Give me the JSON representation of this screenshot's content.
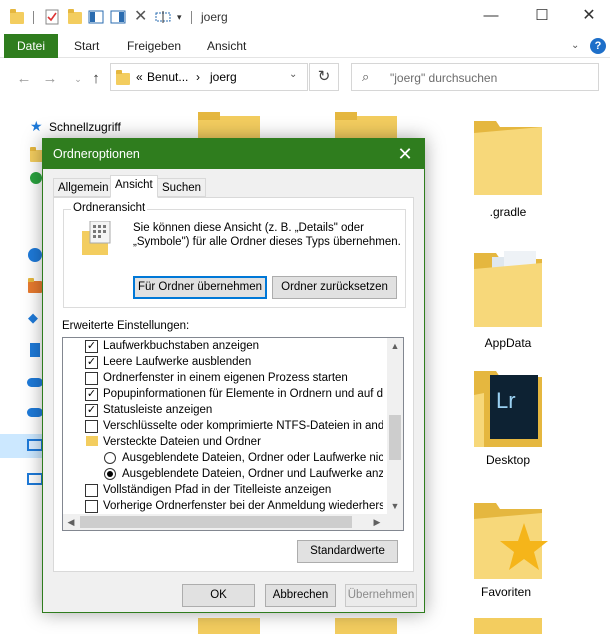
{
  "window": {
    "title": "joerg",
    "ribbon_tabs": [
      "Datei",
      "Start",
      "Freigeben",
      "Ansicht"
    ]
  },
  "address": {
    "prefix": "«",
    "crumb1": "Benut...",
    "sep": "›",
    "crumb2": "joerg",
    "search_placeholder": "\"joerg\" durchsuchen"
  },
  "navpane": {
    "quick_access": "Schnellzugriff"
  },
  "files": [
    {
      "name": ".gradle"
    },
    {
      "name": "AppData"
    },
    {
      "name": "Desktop"
    },
    {
      "name": "Favoriten"
    }
  ],
  "dialog": {
    "title": "Ordneroptionen",
    "tabs": [
      "Allgemein",
      "Ansicht",
      "Suchen"
    ],
    "group_label": "Ordneransicht",
    "group_text": "Sie können diese Ansicht (z. B. „Details\" oder „Symbole\") für alle Ordner dieses Typs übernehmen.",
    "apply_button": "Für Ordner übernehmen",
    "reset_button": "Ordner zurücksetzen",
    "advanced_label": "Erweiterte Einstellungen:",
    "settings": [
      {
        "type": "checkbox",
        "checked": true,
        "label": "Laufwerkbuchstaben anzeigen"
      },
      {
        "type": "checkbox",
        "checked": true,
        "label": "Leere Laufwerke ausblenden"
      },
      {
        "type": "checkbox",
        "checked": false,
        "label": "Ordnerfenster in einem eigenen Prozess starten"
      },
      {
        "type": "checkbox",
        "checked": true,
        "label": "Popupinformationen für Elemente in Ordnern und auf dem D"
      },
      {
        "type": "checkbox",
        "checked": true,
        "label": "Statusleiste anzeigen"
      },
      {
        "type": "checkbox",
        "checked": false,
        "label": "Verschlüsselte oder komprimierte NTFS-Dateien in anderer"
      },
      {
        "type": "folder",
        "checked": false,
        "label": "Versteckte Dateien und Ordner"
      },
      {
        "type": "radio",
        "checked": false,
        "label": "Ausgeblendete Dateien, Ordner oder Laufwerke nicht a"
      },
      {
        "type": "radio",
        "checked": true,
        "label": "Ausgeblendete Dateien, Ordner und Laufwerke anzeig"
      },
      {
        "type": "checkbox",
        "checked": false,
        "label": "Vollständigen Pfad in der Titelleiste anzeigen"
      },
      {
        "type": "checkbox",
        "checked": false,
        "label": "Vorherige Ordnerfenster bei der Anmeldung wiederherstellen"
      }
    ],
    "defaults_button": "Standardwerte",
    "ok_button": "OK",
    "cancel_button": "Abbrechen",
    "apply_dialog_button": "Übernehmen"
  },
  "colors": {
    "accent": "#2f7d1e",
    "folder": "#f3cd5f"
  }
}
